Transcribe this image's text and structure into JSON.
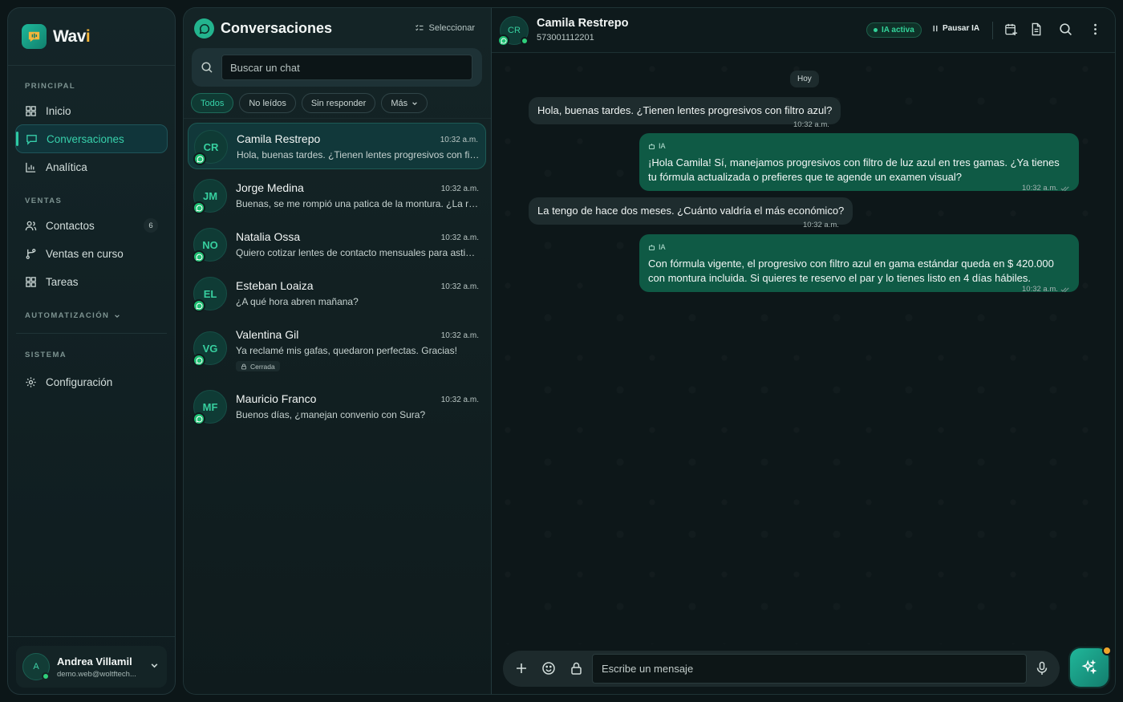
{
  "brand": {
    "name_main": "Wav",
    "name_accent": "i"
  },
  "sidebar": {
    "sections": {
      "principal": "PRINCIPAL",
      "ventas": "VENTAS",
      "automatizacion": "AUTOMATIZACIÓN",
      "sistema": "SISTEMA"
    },
    "items": [
      {
        "label": "Inicio",
        "icon": "grid-icon"
      },
      {
        "label": "Conversaciones",
        "icon": "chat-icon",
        "active": true
      },
      {
        "label": "Analítica",
        "icon": "bar-chart-icon"
      },
      {
        "label": "Contactos",
        "icon": "users-icon",
        "badge": "6"
      },
      {
        "label": "Ventas en curso",
        "icon": "branch-icon"
      },
      {
        "label": "Tareas",
        "icon": "grid-icon"
      },
      {
        "label": "Configuración",
        "icon": "gear-icon"
      }
    ],
    "user": {
      "initial": "A",
      "name": "Andrea Villamil",
      "email": "demo.web@woltftech..."
    }
  },
  "chatlist": {
    "title": "Conversaciones",
    "select_label": "Seleccionar",
    "search_placeholder": "Buscar un chat",
    "filters": [
      "Todos",
      "No leídos",
      "Sin responder",
      "Más"
    ],
    "conversations": [
      {
        "initials": "CR",
        "name": "Camila Restrepo",
        "time": "10:32 a.m.",
        "preview": "Hola, buenas tardes. ¿Tienen lentes progresivos con filtro azul?"
      },
      {
        "initials": "JM",
        "name": "Jorge Medina",
        "time": "10:32 a.m.",
        "preview": "Buenas, se me rompió una patica de la montura. ¿La reparan?"
      },
      {
        "initials": "NO",
        "name": "Natalia Ossa",
        "time": "10:32 a.m.",
        "preview": "Quiero cotizar lentes de contacto mensuales para astigmatismo"
      },
      {
        "initials": "EL",
        "name": "Esteban Loaiza",
        "time": "10:32 a.m.",
        "preview": "¿A qué hora abren mañana?"
      },
      {
        "initials": "VG",
        "name": "Valentina Gil",
        "time": "10:32 a.m.",
        "preview": "Ya reclamé mis gafas, quedaron perfectas. Gracias!",
        "tag": "Cerrada"
      },
      {
        "initials": "MF",
        "name": "Mauricio Franco",
        "time": "10:32 a.m.",
        "preview": "Buenos días, ¿manejan convenio con Sura?"
      }
    ]
  },
  "chat": {
    "contact": {
      "initials": "CR",
      "name": "Camila Restrepo",
      "phone": "573001112201"
    },
    "ia_status": "IA activa",
    "pause_label": "Pausar IA",
    "day_label": "Hoy",
    "ia_tag": "IA",
    "messages": [
      {
        "dir": "in",
        "text": "Hola, buenas tardes. ¿Tienen lentes progresivos con filtro azul?",
        "time": "10:32 a.m."
      },
      {
        "dir": "out",
        "text": "¡Hola Camila! Sí, manejamos progresivos con filtro de luz azul en tres gamas. ¿Ya tienes tu fórmula actualizada o prefieres que te agende un examen visual?",
        "time": "10:32 a.m."
      },
      {
        "dir": "in",
        "text": "La tengo de hace dos meses. ¿Cuánto valdría el más económico?",
        "time": "10:32 a.m."
      },
      {
        "dir": "out",
        "text": "Con fórmula vigente, el progresivo con filtro azul en gama estándar queda en $ 420.000 con montura incluida. Si quieres te reservo el par y lo tienes listo en 4 días hábiles.",
        "time": "10:32 a.m."
      }
    ],
    "composer_placeholder": "Escribe un mensaje"
  },
  "colors": {
    "accent": "#2ec9a3",
    "bubble_out": "#0f5a45",
    "bubble_in": "#1e2c2e",
    "whatsapp": "#1fbf73",
    "notice": "#f0a52a"
  }
}
